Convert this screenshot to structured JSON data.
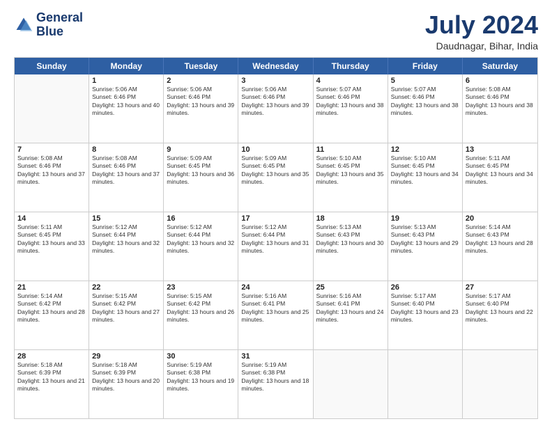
{
  "logo": {
    "line1": "General",
    "line2": "Blue"
  },
  "title": "July 2024",
  "subtitle": "Daudnagar, Bihar, India",
  "days": [
    "Sunday",
    "Monday",
    "Tuesday",
    "Wednesday",
    "Thursday",
    "Friday",
    "Saturday"
  ],
  "weeks": [
    [
      {
        "day": "",
        "sunrise": "",
        "sunset": "",
        "daylight": ""
      },
      {
        "day": "1",
        "sunrise": "Sunrise: 5:06 AM",
        "sunset": "Sunset: 6:46 PM",
        "daylight": "Daylight: 13 hours and 40 minutes."
      },
      {
        "day": "2",
        "sunrise": "Sunrise: 5:06 AM",
        "sunset": "Sunset: 6:46 PM",
        "daylight": "Daylight: 13 hours and 39 minutes."
      },
      {
        "day": "3",
        "sunrise": "Sunrise: 5:06 AM",
        "sunset": "Sunset: 6:46 PM",
        "daylight": "Daylight: 13 hours and 39 minutes."
      },
      {
        "day": "4",
        "sunrise": "Sunrise: 5:07 AM",
        "sunset": "Sunset: 6:46 PM",
        "daylight": "Daylight: 13 hours and 38 minutes."
      },
      {
        "day": "5",
        "sunrise": "Sunrise: 5:07 AM",
        "sunset": "Sunset: 6:46 PM",
        "daylight": "Daylight: 13 hours and 38 minutes."
      },
      {
        "day": "6",
        "sunrise": "Sunrise: 5:08 AM",
        "sunset": "Sunset: 6:46 PM",
        "daylight": "Daylight: 13 hours and 38 minutes."
      }
    ],
    [
      {
        "day": "7",
        "sunrise": "Sunrise: 5:08 AM",
        "sunset": "Sunset: 6:46 PM",
        "daylight": "Daylight: 13 hours and 37 minutes."
      },
      {
        "day": "8",
        "sunrise": "Sunrise: 5:08 AM",
        "sunset": "Sunset: 6:46 PM",
        "daylight": "Daylight: 13 hours and 37 minutes."
      },
      {
        "day": "9",
        "sunrise": "Sunrise: 5:09 AM",
        "sunset": "Sunset: 6:45 PM",
        "daylight": "Daylight: 13 hours and 36 minutes."
      },
      {
        "day": "10",
        "sunrise": "Sunrise: 5:09 AM",
        "sunset": "Sunset: 6:45 PM",
        "daylight": "Daylight: 13 hours and 35 minutes."
      },
      {
        "day": "11",
        "sunrise": "Sunrise: 5:10 AM",
        "sunset": "Sunset: 6:45 PM",
        "daylight": "Daylight: 13 hours and 35 minutes."
      },
      {
        "day": "12",
        "sunrise": "Sunrise: 5:10 AM",
        "sunset": "Sunset: 6:45 PM",
        "daylight": "Daylight: 13 hours and 34 minutes."
      },
      {
        "day": "13",
        "sunrise": "Sunrise: 5:11 AM",
        "sunset": "Sunset: 6:45 PM",
        "daylight": "Daylight: 13 hours and 34 minutes."
      }
    ],
    [
      {
        "day": "14",
        "sunrise": "Sunrise: 5:11 AM",
        "sunset": "Sunset: 6:45 PM",
        "daylight": "Daylight: 13 hours and 33 minutes."
      },
      {
        "day": "15",
        "sunrise": "Sunrise: 5:12 AM",
        "sunset": "Sunset: 6:44 PM",
        "daylight": "Daylight: 13 hours and 32 minutes."
      },
      {
        "day": "16",
        "sunrise": "Sunrise: 5:12 AM",
        "sunset": "Sunset: 6:44 PM",
        "daylight": "Daylight: 13 hours and 32 minutes."
      },
      {
        "day": "17",
        "sunrise": "Sunrise: 5:12 AM",
        "sunset": "Sunset: 6:44 PM",
        "daylight": "Daylight: 13 hours and 31 minutes."
      },
      {
        "day": "18",
        "sunrise": "Sunrise: 5:13 AM",
        "sunset": "Sunset: 6:43 PM",
        "daylight": "Daylight: 13 hours and 30 minutes."
      },
      {
        "day": "19",
        "sunrise": "Sunrise: 5:13 AM",
        "sunset": "Sunset: 6:43 PM",
        "daylight": "Daylight: 13 hours and 29 minutes."
      },
      {
        "day": "20",
        "sunrise": "Sunrise: 5:14 AM",
        "sunset": "Sunset: 6:43 PM",
        "daylight": "Daylight: 13 hours and 28 minutes."
      }
    ],
    [
      {
        "day": "21",
        "sunrise": "Sunrise: 5:14 AM",
        "sunset": "Sunset: 6:42 PM",
        "daylight": "Daylight: 13 hours and 28 minutes."
      },
      {
        "day": "22",
        "sunrise": "Sunrise: 5:15 AM",
        "sunset": "Sunset: 6:42 PM",
        "daylight": "Daylight: 13 hours and 27 minutes."
      },
      {
        "day": "23",
        "sunrise": "Sunrise: 5:15 AM",
        "sunset": "Sunset: 6:42 PM",
        "daylight": "Daylight: 13 hours and 26 minutes."
      },
      {
        "day": "24",
        "sunrise": "Sunrise: 5:16 AM",
        "sunset": "Sunset: 6:41 PM",
        "daylight": "Daylight: 13 hours and 25 minutes."
      },
      {
        "day": "25",
        "sunrise": "Sunrise: 5:16 AM",
        "sunset": "Sunset: 6:41 PM",
        "daylight": "Daylight: 13 hours and 24 minutes."
      },
      {
        "day": "26",
        "sunrise": "Sunrise: 5:17 AM",
        "sunset": "Sunset: 6:40 PM",
        "daylight": "Daylight: 13 hours and 23 minutes."
      },
      {
        "day": "27",
        "sunrise": "Sunrise: 5:17 AM",
        "sunset": "Sunset: 6:40 PM",
        "daylight": "Daylight: 13 hours and 22 minutes."
      }
    ],
    [
      {
        "day": "28",
        "sunrise": "Sunrise: 5:18 AM",
        "sunset": "Sunset: 6:39 PM",
        "daylight": "Daylight: 13 hours and 21 minutes."
      },
      {
        "day": "29",
        "sunrise": "Sunrise: 5:18 AM",
        "sunset": "Sunset: 6:39 PM",
        "daylight": "Daylight: 13 hours and 20 minutes."
      },
      {
        "day": "30",
        "sunrise": "Sunrise: 5:19 AM",
        "sunset": "Sunset: 6:38 PM",
        "daylight": "Daylight: 13 hours and 19 minutes."
      },
      {
        "day": "31",
        "sunrise": "Sunrise: 5:19 AM",
        "sunset": "Sunset: 6:38 PM",
        "daylight": "Daylight: 13 hours and 18 minutes."
      },
      {
        "day": "",
        "sunrise": "",
        "sunset": "",
        "daylight": ""
      },
      {
        "day": "",
        "sunrise": "",
        "sunset": "",
        "daylight": ""
      },
      {
        "day": "",
        "sunrise": "",
        "sunset": "",
        "daylight": ""
      }
    ]
  ]
}
